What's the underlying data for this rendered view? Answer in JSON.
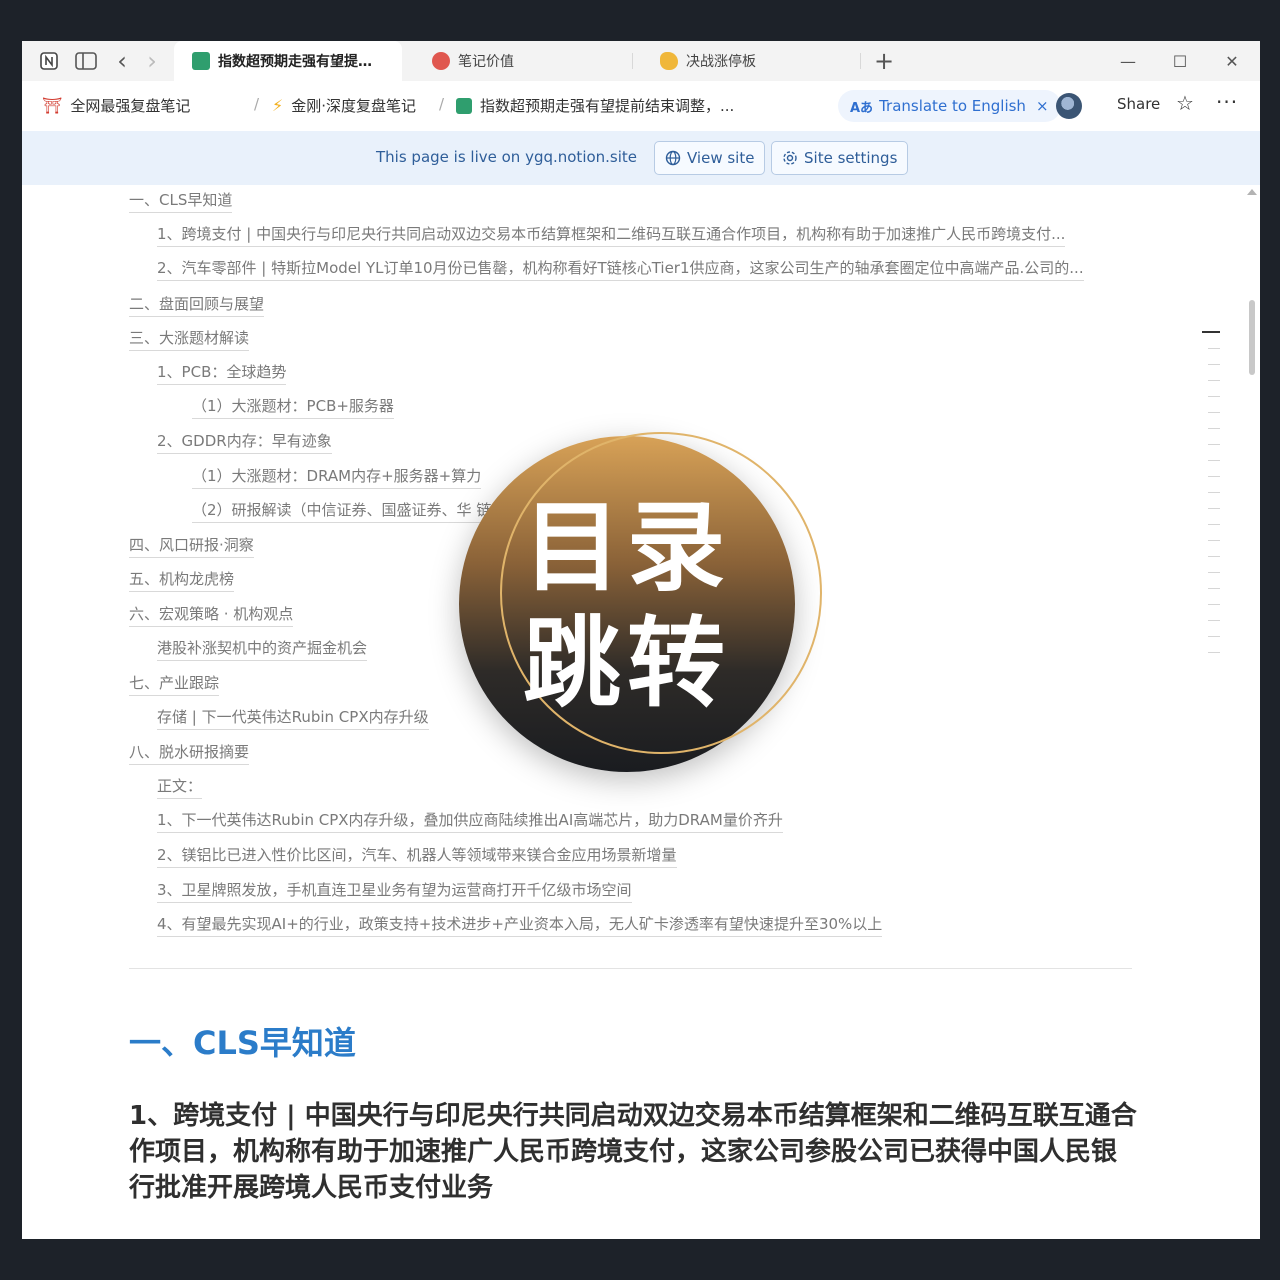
{
  "browser": {
    "tabs": [
      {
        "title": "指数超预期走强有望提…",
        "active": true,
        "favicon_color": "#2f9e6e"
      },
      {
        "title": "笔记价值",
        "active": false,
        "favicon_color": "#e0574f"
      },
      {
        "title": "决战涨停板",
        "active": false,
        "favicon_color": "#f0b73a"
      }
    ],
    "new_tab_label": "+",
    "nav": {
      "back": "‹",
      "forward": "›"
    },
    "window_controls": {
      "minimize": "—",
      "maximize": "☐",
      "close": "✕"
    }
  },
  "breadcrumbs": [
    {
      "label": "全网最强复盘笔记",
      "icon": "torii-gate-icon",
      "icon_color": "#d23b2f"
    },
    {
      "label": "金刚·深度复盘笔记",
      "icon": "lightning-icon",
      "icon_color": "#f2b01e"
    },
    {
      "label": "指数超预期走强有望提前结束调整，...",
      "icon": "money-bag-icon",
      "icon_color": "#2f9e6e"
    }
  ],
  "breadcrumb_separator": "/",
  "toolbar": {
    "translate_label": "Translate to English",
    "translate_close": "×",
    "share_label": "Share",
    "favorite_icon": "☆",
    "more_icon": "···"
  },
  "banner": {
    "text": "This page is live on ygq.notion.site",
    "view_site_label": "View site",
    "site_settings_label": "Site settings"
  },
  "toc": [
    {
      "text": "一、CLS早知道",
      "level": 0
    },
    {
      "text": "1、跨境支付 | 中国央行与印尼央行共同启动双边交易本币结算框架和二维码互联互通合作项目，机构称有助于加速推广人民币跨境支付...",
      "level": 1
    },
    {
      "text": "2、汽车零部件 | 特斯拉Model YL订单10月份已售罄，机构称看好T链核心Tier1供应商，这家公司生产的轴承套圈定位中高端产品.公司的...",
      "level": 1
    },
    {
      "text": "二、盘面回顾与展望",
      "level": 0
    },
    {
      "text": "三、大涨题材解读",
      "level": 0
    },
    {
      "text": "1、PCB：全球趋势",
      "level": 1
    },
    {
      "text": "（1）大涨题材：PCB+服务器",
      "level": 2
    },
    {
      "text": "2、GDDR内存：早有迹象",
      "level": 1
    },
    {
      "text": "（1）大涨题材：DRAM内存+服务器+算力",
      "level": 2
    },
    {
      "text": "（2）研报解读（中信证券、国盛证券、华                                                                                              链产业",
      "level": 2
    },
    {
      "text": "四、风口研报·洞察",
      "level": 0
    },
    {
      "text": "五、机构龙虎榜",
      "level": 0
    },
    {
      "text": "六、宏观策略 · 机构观点",
      "level": 0
    },
    {
      "text": "港股补涨契机中的资产掘金机会",
      "level": 1
    },
    {
      "text": "七、产业跟踪",
      "level": 0
    },
    {
      "text": "存储 | 下一代英伟达Rubin CPX内存升级",
      "level": 1
    },
    {
      "text": "八、脱水研报摘要",
      "level": 0
    },
    {
      "text": "正文：",
      "level": 1
    },
    {
      "text": "1、下一代英伟达Rubin CPX内存升级，叠加供应商陆续推出AI高端芯片，助力DRAM量价齐升",
      "level": 1
    },
    {
      "text": "2、镁铝比已进入性价比区间，汽车、机器人等领域带来镁合金应用场景新增量",
      "level": 1
    },
    {
      "text": "3、卫星牌照发放，手机直连卫星业务有望为运营商打开千亿级市场空间",
      "level": 1
    },
    {
      "text": "4、有望最先实现AI+的行业，政策支持+技术进步+产业资本入局，无人矿卡渗透率有望快速提升至30%以上",
      "level": 1
    }
  ],
  "section": {
    "heading": "一、CLS早知道",
    "subheading": "1、跨境支付 | 中国央行与印尼央行共同启动双边交易本币结算框架和二维码互联互通合作项目，机构称有助于加速推广人民币跨境支付，这家公司参股公司已获得中国人民银行批准开展跨境人民币支付业务"
  },
  "overlay": {
    "line1": "目录",
    "line2": "跳转"
  },
  "colors": {
    "heading_blue": "#2b7cc9",
    "banner_bg": "#e9f1fb",
    "badge_gold": "#d8a257"
  }
}
